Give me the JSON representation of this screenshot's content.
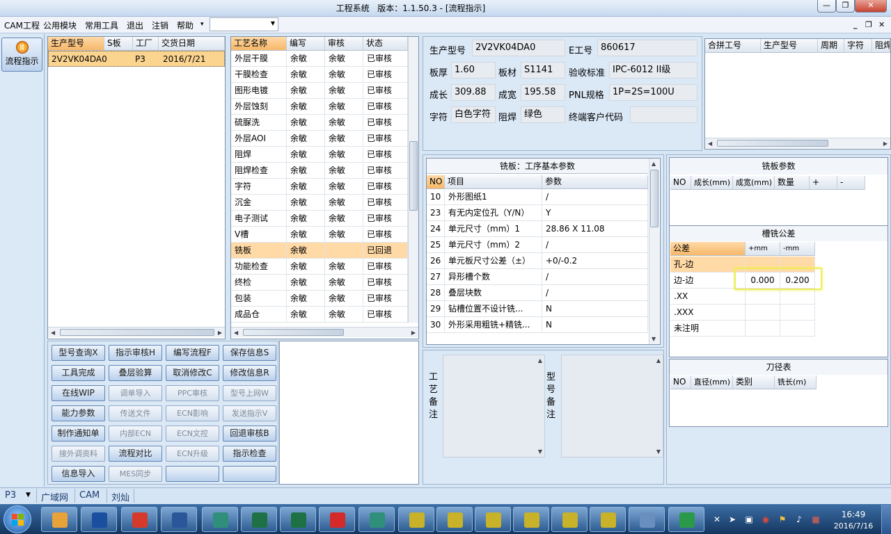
{
  "title": "工程系统   版本：1.1.50.3 - [流程指示]",
  "menu": [
    "CAM工程",
    "公用模块",
    "常用工具",
    "退出",
    "注销",
    "帮助"
  ],
  "menu_arrow": "▾",
  "nav": {
    "label": "流程指示"
  },
  "orders": {
    "headers": [
      "生产型号",
      "S板",
      "工厂",
      "交货日期"
    ],
    "rows": [
      [
        "2V2VK04DA0",
        "",
        "P3",
        "2016/7/21"
      ]
    ]
  },
  "process": {
    "headers": [
      "工艺名称",
      "编写",
      "审核",
      "状态"
    ],
    "rows": [
      [
        "外层干膜",
        "余敏",
        "余敏",
        "已审核"
      ],
      [
        "干膜检查",
        "余敏",
        "余敏",
        "已审核"
      ],
      [
        "图形电镀",
        "余敏",
        "余敏",
        "已审核"
      ],
      [
        "外层蚀刻",
        "余敏",
        "余敏",
        "已审核"
      ],
      [
        "硫脲洗",
        "余敏",
        "余敏",
        "已审核"
      ],
      [
        "外层AOI",
        "余敏",
        "余敏",
        "已审核"
      ],
      [
        "阻焊",
        "余敏",
        "余敏",
        "已审核"
      ],
      [
        "阻焊检查",
        "余敏",
        "余敏",
        "已审核"
      ],
      [
        "字符",
        "余敏",
        "余敏",
        "已审核"
      ],
      [
        "沉金",
        "余敏",
        "余敏",
        "已审核"
      ],
      [
        "电子测试",
        "余敏",
        "余敏",
        "已审核"
      ],
      [
        "V槽",
        "余敏",
        "余敏",
        "已审核"
      ],
      [
        "铣板",
        "余敏",
        "",
        "已回退"
      ],
      [
        "功能检查",
        "余敏",
        "余敏",
        "已审核"
      ],
      [
        "终检",
        "余敏",
        "余敏",
        "已审核"
      ],
      [
        "包装",
        "余敏",
        "余敏",
        "已审核"
      ],
      [
        "成品仓",
        "余敏",
        "余敏",
        "已审核"
      ]
    ]
  },
  "buttons": [
    [
      "型号查询X",
      "指示审核H",
      "编写流程F",
      "保存信息S"
    ],
    [
      "工具完成",
      "叠层验算",
      "取消修改C",
      "修改信息R"
    ],
    [
      "在线WIP",
      "调单导入",
      "PPC审核",
      "型号上网W"
    ],
    [
      "能力参数",
      "传送文件",
      "ECN影响",
      "发送指示V"
    ],
    [
      "制作通知单",
      "内部ECN",
      "ECN文控",
      "回退审核B"
    ],
    [
      "接外调资料",
      "流程对比",
      "ECN升级",
      "指示检查"
    ],
    [
      "信息导入",
      "MES同步",
      "",
      ""
    ]
  ],
  "info": {
    "model_label": "生产型号",
    "model": "2V2VK04DA0",
    "ejob_label": "E工号",
    "ejob": "860617",
    "thick_label": "板厚",
    "thick": "1.60",
    "mat_label": "板材",
    "mat": "S1141",
    "std_label": "验收标准",
    "std": "IPC-6012 II级",
    "length_label": "成长",
    "length": "309.88",
    "width_label": "成宽",
    "width": "195.58",
    "pnl_label": "PNL规格",
    "pnl": "1P=2S=100U",
    "char_label": "字符",
    "char": "白色字符",
    "mask_label": "阻焊",
    "mask": "绿色",
    "cust_label": "终端客户代码",
    "cust": ""
  },
  "merge": {
    "headers": [
      "合拼工号",
      "生产型号",
      "周期",
      "字符",
      "阻焊"
    ]
  },
  "params": {
    "title": "铣板：工序基本参数",
    "headers": [
      "NO",
      "项目",
      "参数"
    ],
    "rows": [
      [
        "10",
        "外形图纸1",
        "/"
      ],
      [
        "23",
        "有无内定位孔（Y/N）",
        "Y"
      ],
      [
        "24",
        "单元尺寸（mm）1",
        "28.86 X 11.08"
      ],
      [
        "25",
        "单元尺寸（mm）2",
        "/"
      ],
      [
        "26",
        "单元板尺寸公差（±）",
        "+0/-0.2"
      ],
      [
        "27",
        "异形槽个数",
        "/"
      ],
      [
        "28",
        "叠层块数",
        "/"
      ],
      [
        "29",
        "钻槽位置不设计铣...",
        "N"
      ],
      [
        "30",
        "外形采用粗铣+精铣...",
        "N"
      ]
    ]
  },
  "remarks": {
    "process": "工艺备注",
    "model": "型号备注"
  },
  "mill": {
    "title": "铣板参数",
    "headers": [
      "NO",
      "成长(mm)",
      "成宽(mm)",
      "数量",
      "+",
      "-"
    ]
  },
  "slot": {
    "title": "槽铣公差",
    "headers": [
      "公差",
      "+mm",
      "-mm"
    ],
    "rows": [
      [
        "孔-边",
        "",
        ""
      ],
      [
        "边-边",
        "0.000",
        "0.200"
      ],
      [
        ".XX",
        "",
        ""
      ],
      [
        ".XXX",
        "",
        ""
      ],
      [
        "未注明",
        "",
        ""
      ]
    ]
  },
  "tools": {
    "title": "刀径表",
    "headers": [
      "NO",
      "直径(mm)",
      "类别",
      "铣长(m)"
    ]
  },
  "status": {
    "factory": "P3",
    "items": [
      "广域网",
      "CAM",
      "刘灿"
    ]
  },
  "clock": {
    "time": "16:49",
    "date": "2016/7/16"
  }
}
